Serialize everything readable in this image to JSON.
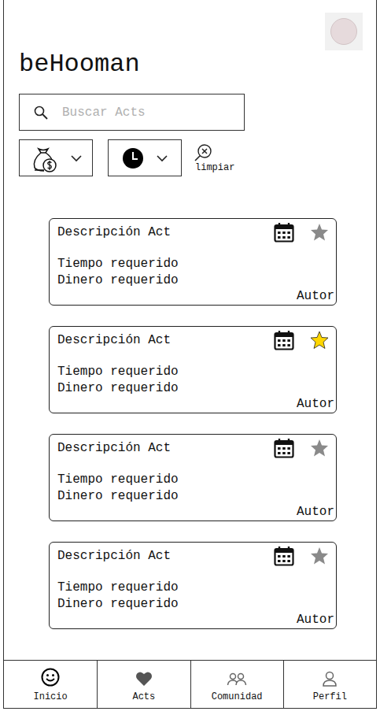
{
  "app": {
    "title": "beHooman"
  },
  "search": {
    "placeholder": "Buscar Acts"
  },
  "filters": {
    "clear": "limpiar"
  },
  "acts": [
    {
      "description": "Descripción Act",
      "time": "Tiempo requerido",
      "money": "Dinero requerido",
      "author": "Autor",
      "favorite": false
    },
    {
      "description": "Descripción Act",
      "time": "Tiempo requerido",
      "money": "Dinero requerido",
      "author": "Autor",
      "favorite": true
    },
    {
      "description": "Descripción Act",
      "time": "Tiempo requerido",
      "money": "Dinero requerido",
      "author": "Autor",
      "favorite": false
    },
    {
      "description": "Descripción Act",
      "time": "Tiempo requerido",
      "money": "Dinero requerido",
      "author": "Autor",
      "favorite": false
    }
  ],
  "nav": [
    {
      "label": "Inicio",
      "selected": true
    },
    {
      "label": "Acts",
      "selected": false
    },
    {
      "label": "Comunidad",
      "selected": false
    },
    {
      "label": "Perfil",
      "selected": false
    }
  ]
}
